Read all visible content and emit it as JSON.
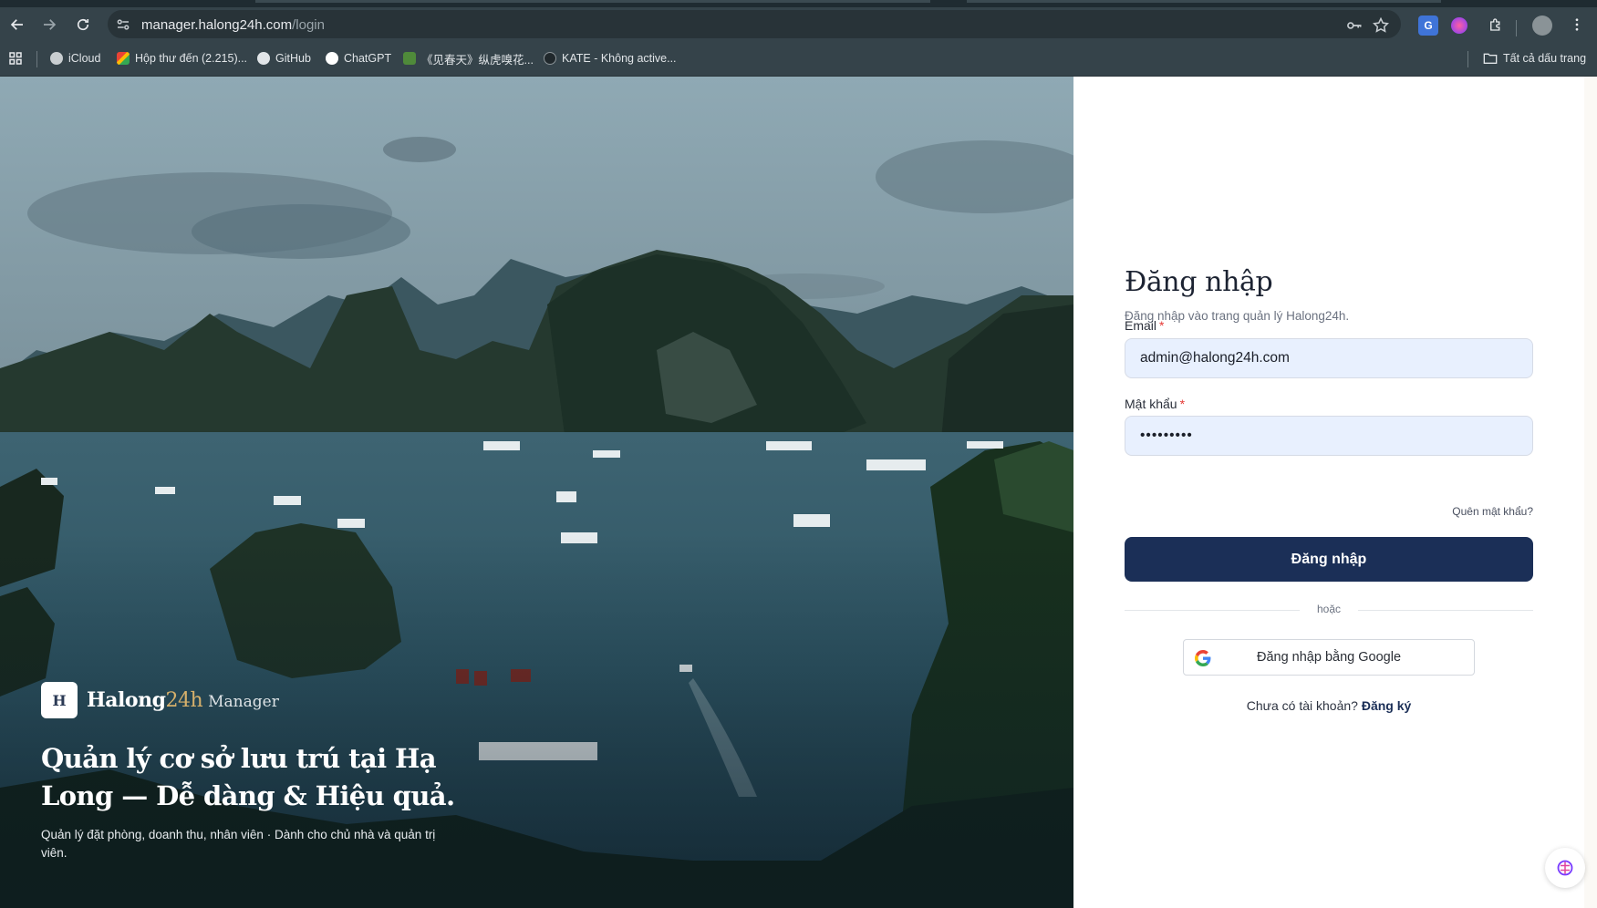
{
  "browser": {
    "url_host": "manager.halong24h.com",
    "url_path": "/login",
    "bookmarks": [
      {
        "label": "iCloud",
        "icon": "apple-icon"
      },
      {
        "label": "Hộp thư đến (2.215)...",
        "icon": "gmail-icon"
      },
      {
        "label": "GitHub",
        "icon": "github-icon"
      },
      {
        "label": "ChatGPT",
        "icon": "openai-icon"
      },
      {
        "label": "《见春天》纵虎嗅花...",
        "icon": "site-icon"
      },
      {
        "label": "KATE - Không active...",
        "icon": "site-icon"
      }
    ],
    "all_bookmarks": "Tất cả dấu trang"
  },
  "hero": {
    "brand_logo": "H",
    "brand_name": "Halong",
    "brand_num": "24h",
    "brand_sub": "Manager",
    "title": "Quản lý cơ sở lưu trú tại Hạ Long — Dễ dàng & Hiệu quả.",
    "subtitle": "Quản lý đặt phòng, doanh thu, nhân viên · Dành cho chủ nhà và quản trị viên."
  },
  "login": {
    "title": "Đăng nhập",
    "subtitle": "Đăng nhập vào trang quản lý Halong24h.",
    "email_label": "Email",
    "email_value": "admin@halong24h.com",
    "password_label": "Mật khẩu",
    "password_value": "•••••••••",
    "required_mark": "*",
    "forgot": "Quên mật khẩu?",
    "submit": "Đăng nhập",
    "or": "hoặc",
    "google": "Đăng nhập bằng Google",
    "no_account": "Chưa có tài khoản?",
    "register": "Đăng ký"
  },
  "colors": {
    "primary": "#1b2f57",
    "input_bg": "#e8f0fe",
    "brand_accent": "#d6b06b",
    "chrome": "#35434a"
  }
}
